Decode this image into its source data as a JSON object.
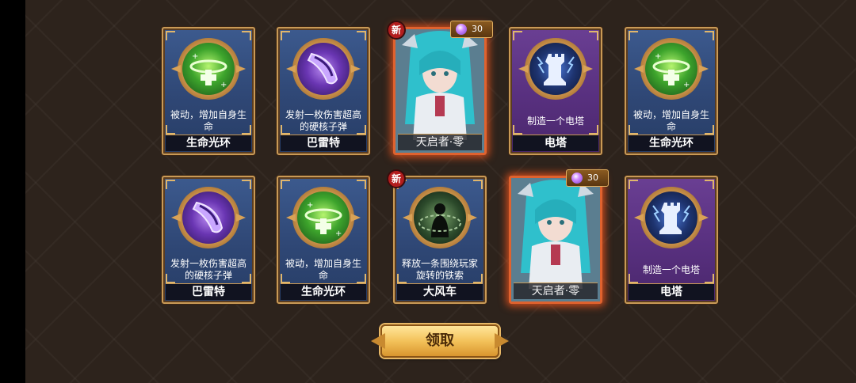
{
  "claim_button": {
    "label": "领取"
  },
  "new_badge_label": "新",
  "cards": [
    {
      "id": "r1c1",
      "type": "skill",
      "theme": "blue",
      "icon": "life-ring-icon",
      "description": "被动，增加自身生命",
      "name": "生命光环"
    },
    {
      "id": "r1c2",
      "type": "skill",
      "theme": "blue",
      "icon": "bullet-icon",
      "description": "发射一枚伤害超高的硬核子弹",
      "name": "巴雷特"
    },
    {
      "id": "r1c3",
      "type": "hero",
      "theme": "hero",
      "name": "天启者·零",
      "is_new": true,
      "cost": "30"
    },
    {
      "id": "r1c4",
      "type": "skill",
      "theme": "purple",
      "icon": "tower-icon",
      "description": "制造一个电塔",
      "name": "电塔"
    },
    {
      "id": "r1c5",
      "type": "skill",
      "theme": "blue",
      "icon": "life-ring-icon",
      "description": "被动，增加自身生命",
      "name": "生命光环"
    },
    {
      "id": "r2c1",
      "type": "skill",
      "theme": "blue",
      "icon": "bullet-icon",
      "description": "发射一枚伤害超高的硬核子弹",
      "name": "巴雷特"
    },
    {
      "id": "r2c2",
      "type": "skill",
      "theme": "blue",
      "icon": "life-ring-icon",
      "description": "被动，增加自身生命",
      "name": "生命光环"
    },
    {
      "id": "r2c3",
      "type": "skill",
      "theme": "blue",
      "icon": "chain-icon",
      "description": "释放一条围绕玩家旋转的铁索",
      "name": "大风车",
      "is_new": true
    },
    {
      "id": "r2c4",
      "type": "hero",
      "theme": "hero",
      "name": "天启者·零",
      "cost": "30"
    },
    {
      "id": "r2c5",
      "type": "skill",
      "theme": "purple",
      "icon": "tower-icon",
      "description": "制造一个电塔",
      "name": "电塔"
    }
  ]
}
